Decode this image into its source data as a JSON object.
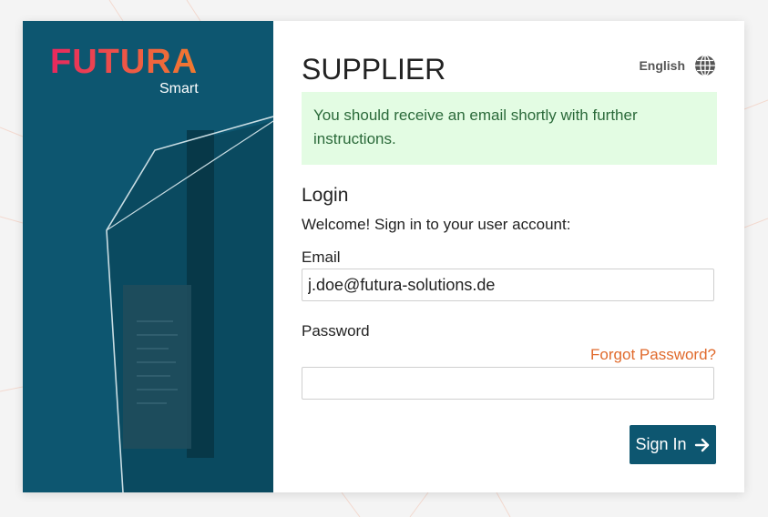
{
  "brand": {
    "name": "FUTURA",
    "sub": "Smart"
  },
  "header": {
    "title": "SUPPLIER",
    "language": "English",
    "language_icon": "globe-icon"
  },
  "alert": {
    "message": "You should receive an email shortly with further instructions."
  },
  "login": {
    "heading": "Login",
    "welcome": "Welcome! Sign in to your user account:",
    "email_label": "Email",
    "email_value": "j.doe@futura-solutions.de",
    "password_label": "Password",
    "password_value": "",
    "forgot_label": "Forgot Password?",
    "signin_label": "Sign In",
    "signin_icon": "arrow-right-icon"
  },
  "colors": {
    "brand_teal": "#0d5670",
    "accent_orange": "#e06a2c",
    "success_bg": "#e3fce3"
  }
}
